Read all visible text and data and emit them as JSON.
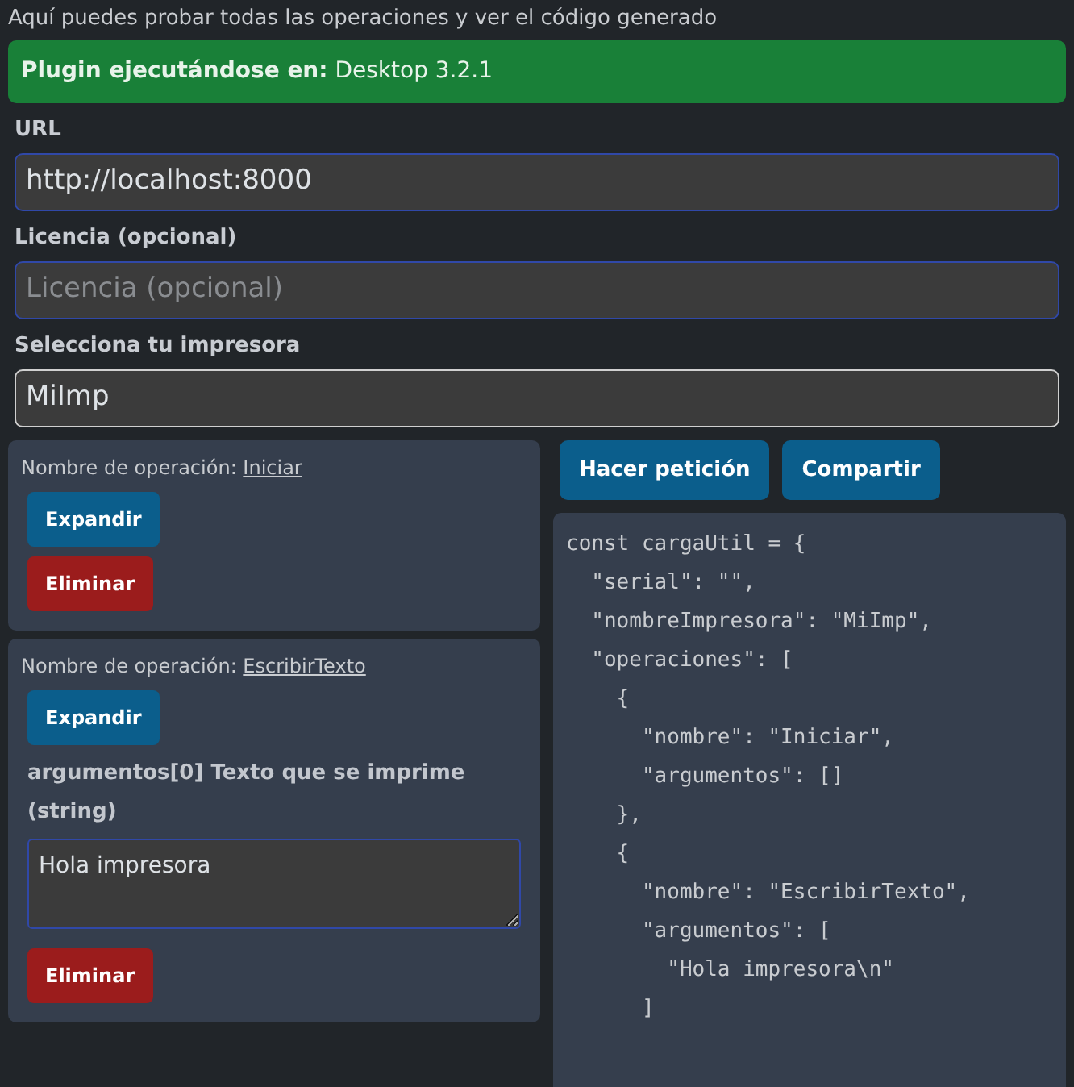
{
  "intro": "Aquí puedes probar todas las operaciones y ver el código generado",
  "status": {
    "label": "Plugin ejecutándose en:",
    "value": "Desktop 3.2.1"
  },
  "fields": [
    {
      "kind": "input",
      "label": "URL",
      "value": "http://localhost:8000"
    },
    {
      "kind": "input",
      "label": "Licencia (opcional)",
      "placeholder": "Licencia (opcional)"
    },
    {
      "kind": "select",
      "label": "Selecciona tu impresora",
      "value": "MiImp"
    }
  ],
  "operations": [
    {
      "label": "Nombre de operación:",
      "name": "Iniciar",
      "expand_button": "Expandir",
      "delete_button": "Eliminar"
    },
    {
      "label": "Nombre de operación:",
      "name": "EscribirTexto",
      "expand_button": "Expandir",
      "arguments": [
        {
          "label": "argumentos[0] Texto que se imprime (string)",
          "value": "Hola impresora"
        }
      ],
      "delete_button": "Eliminar"
    }
  ],
  "actions": [
    "Hacer petición",
    "Compartir"
  ],
  "code_lines": [
    "const cargaUtil = {",
    "  \"serial\": \"\",",
    "  \"nombreImpresora\": \"MiImp\",",
    "  \"operaciones\": [",
    "    {",
    "      \"nombre\": \"Iniciar\",",
    "      \"argumentos\": []",
    "    },",
    "    {",
    "      \"nombre\": \"EscribirTexto\",",
    "      \"argumentos\": [",
    "        \"Hola impresora\\n\"",
    "      ]"
  ]
}
